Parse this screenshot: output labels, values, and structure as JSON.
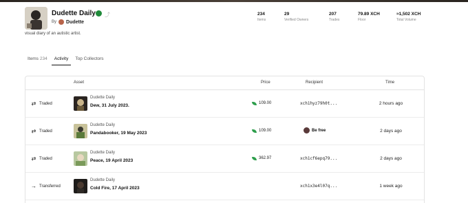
{
  "collection": {
    "title": "Dudette Daily",
    "by_label": "By",
    "creator": "Dudette",
    "description": "visual diary of an autistic artist."
  },
  "stats": [
    {
      "value": "234",
      "label": "Items"
    },
    {
      "value": "29",
      "label": "Verified Owners"
    },
    {
      "value": "207",
      "label": "Trades"
    },
    {
      "value": "79.89 XCH",
      "label": "Floor"
    },
    {
      "value": "≈1,502 XCH",
      "label": "Total Volume"
    }
  ],
  "tabs": [
    {
      "label": "Items",
      "count": "234"
    },
    {
      "label": "Activity",
      "count": ""
    },
    {
      "label": "Top Collectors",
      "count": ""
    }
  ],
  "table": {
    "headers": {
      "asset": "Asset",
      "price": "Price",
      "recipient": "Recipient",
      "time": "Time"
    },
    "rows": [
      {
        "event": "Traded",
        "event_icon": "swap-icon",
        "collection": "Dudette Daily",
        "name": "Dew, 31 July 2023.",
        "price": "109.00",
        "recipient": "xch1hyz79h0t...",
        "recipient_type": "address",
        "time": "2 hours ago"
      },
      {
        "event": "Traded",
        "event_icon": "swap-icon",
        "collection": "Dudette Daily",
        "name": "Pandabooker, 19 May 2023",
        "price": "109.00",
        "recipient": "Be free",
        "recipient_type": "user",
        "time": "2 days ago"
      },
      {
        "event": "Traded",
        "event_icon": "swap-icon",
        "collection": "Dudette Daily",
        "name": "Peace, 19 April 2023",
        "price": "362.97",
        "recipient": "xch1cf6epq79...",
        "recipient_type": "address",
        "time": "2 days ago"
      },
      {
        "event": "Transferred",
        "event_icon": "arrow-right-icon",
        "collection": "Dudette Daily",
        "name": "Cold Fire, 17 April 2023",
        "price": "",
        "recipient": "xch1x3e4l07q...",
        "recipient_type": "address",
        "time": "1 week ago"
      }
    ]
  },
  "colors": {
    "accent": "#1f8a3a",
    "price_leaf": "#2e9e4c"
  }
}
